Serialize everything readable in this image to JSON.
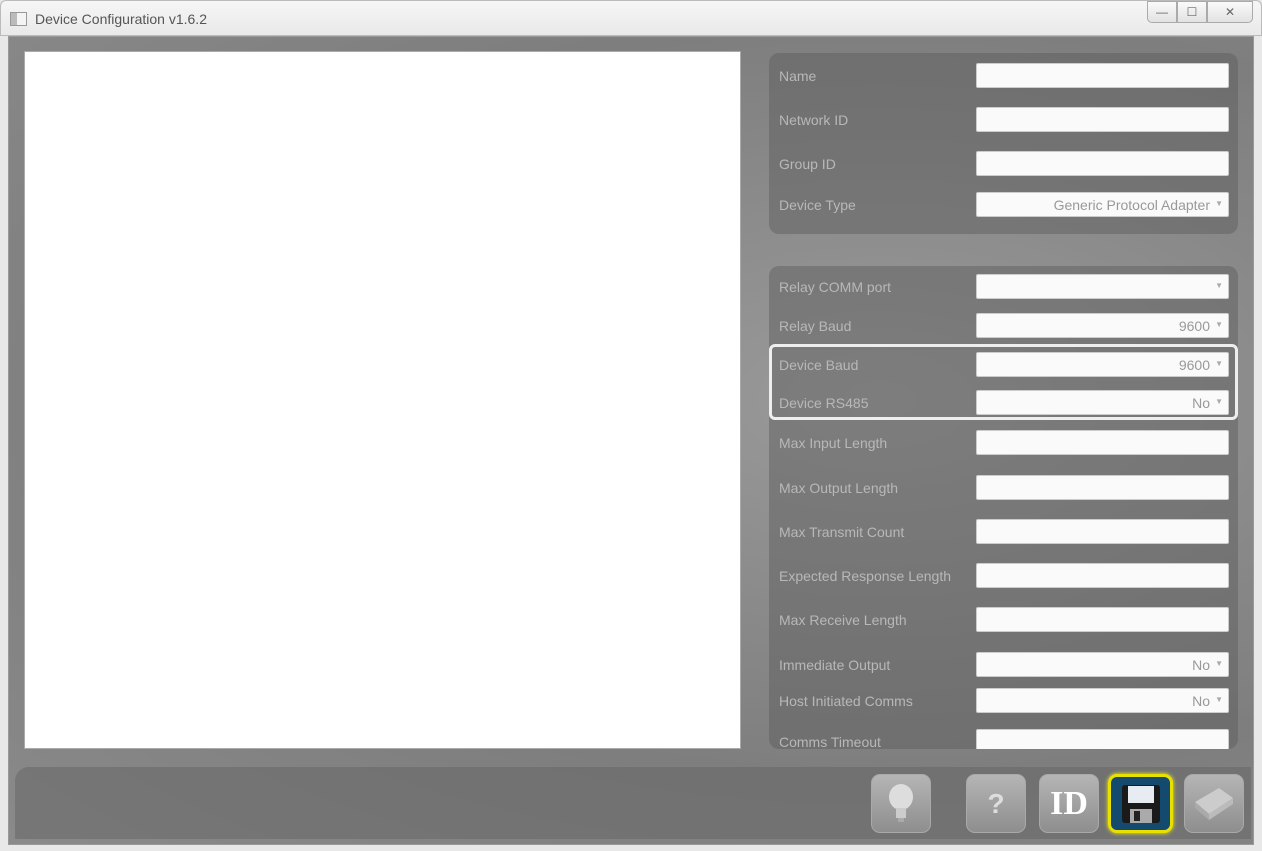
{
  "window": {
    "title": "Device Configuration v1.6.2"
  },
  "device": {
    "name_label": "Name",
    "name_value": "",
    "network_id_label": "Network ID",
    "network_id_value": "",
    "group_id_label": "Group ID",
    "group_id_value": "",
    "device_type_label": "Device Type",
    "device_type_value": "Generic Protocol Adapter"
  },
  "comms": {
    "rows": [
      {
        "label": "Relay COMM port",
        "value": "",
        "type": "select"
      },
      {
        "label": "Relay Baud",
        "value": "9600",
        "type": "select"
      },
      {
        "label": "Device Baud",
        "value": "9600",
        "type": "select"
      },
      {
        "label": "Device RS485",
        "value": "No",
        "type": "select"
      },
      {
        "label": "Max Input Length",
        "value": "",
        "type": "input"
      },
      {
        "label": "Max Output Length",
        "value": "",
        "type": "input"
      },
      {
        "label": "Max Transmit Count",
        "value": "",
        "type": "input"
      },
      {
        "label": "Expected Response Length",
        "value": "",
        "type": "input"
      },
      {
        "label": "Max Receive Length",
        "value": "",
        "type": "input"
      },
      {
        "label": "Immediate Output",
        "value": "No",
        "type": "select"
      },
      {
        "label": "Host Initiated Comms",
        "value": "No",
        "type": "select"
      },
      {
        "label": "Comms Timeout",
        "value": "",
        "type": "input"
      }
    ]
  },
  "toolbar": {
    "help_label": "?",
    "id_label": "ID",
    "icons": [
      "lightbulb-icon",
      "help-icon",
      "id-icon",
      "save-icon",
      "chip-icon"
    ],
    "save_highlight": "#e8e000"
  }
}
